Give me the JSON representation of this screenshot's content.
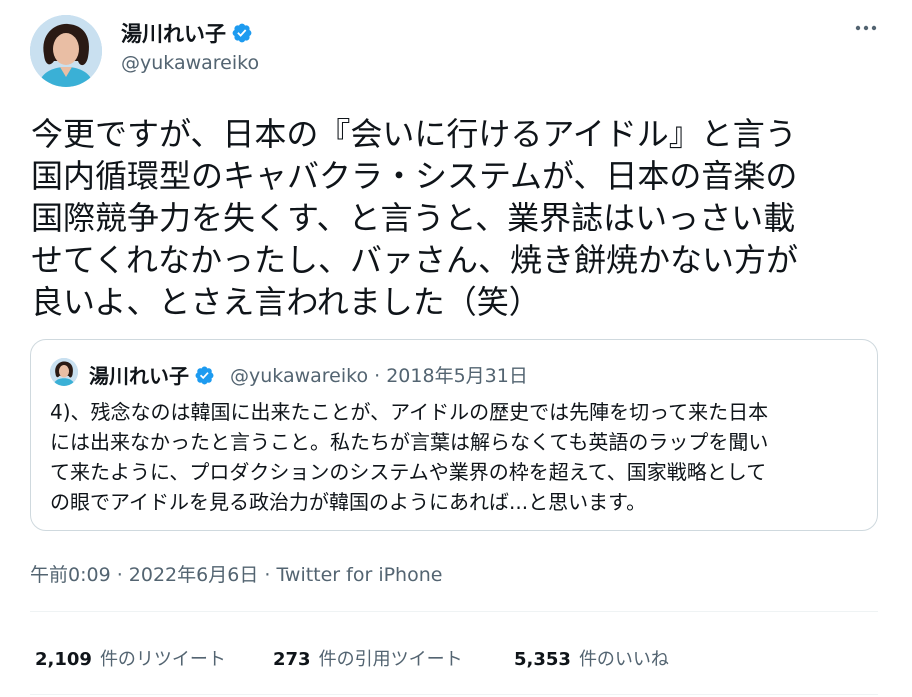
{
  "author": {
    "name": "湯川れい子",
    "handle": "@yukawareiko"
  },
  "tweet": {
    "text": "今更ですが、日本の『会いに行けるアイドル』と言う\n国内循環型のキャバクラ・システムが、日本の音楽の\n国際競争力を失くす、と言うと、業界誌はいっさい載\nせてくれなかったし、バァさん、焼き餅焼かない方が\n良いよ、とさえ言われました（笑）"
  },
  "quoted": {
    "name": "湯川れい子",
    "handle_date": "@yukawareiko · 2018年5月31日",
    "text": "4)、残念なのは韓国に出来たことが、アイドルの歴史では先陣を切って来た日本\nには出来なかったと言うこと。私たちが言葉は解らなくても英語のラップを聞い\nて来たように、プロダクションのシステムや業界の枠を超えて、国家戦略として\nの眼でアイドルを見る政治力が韓国のようにあれば...と思います。"
  },
  "meta": {
    "time_date": "午前0:09 · 2022年6月6日 · ",
    "source": "Twitter for iPhone"
  },
  "stats": {
    "retweets": {
      "count": "2,109",
      "label": "件のリツイート"
    },
    "quotes": {
      "count": "273",
      "label": "件の引用ツイート"
    },
    "likes": {
      "count": "5,353",
      "label": "件のいいね"
    }
  },
  "colors": {
    "verified": "#1d9bf0",
    "secondary_text": "#536471",
    "border": "#cfd9de"
  },
  "icons": {
    "verified": "verified-badge-icon",
    "more": "more-options-icon"
  }
}
